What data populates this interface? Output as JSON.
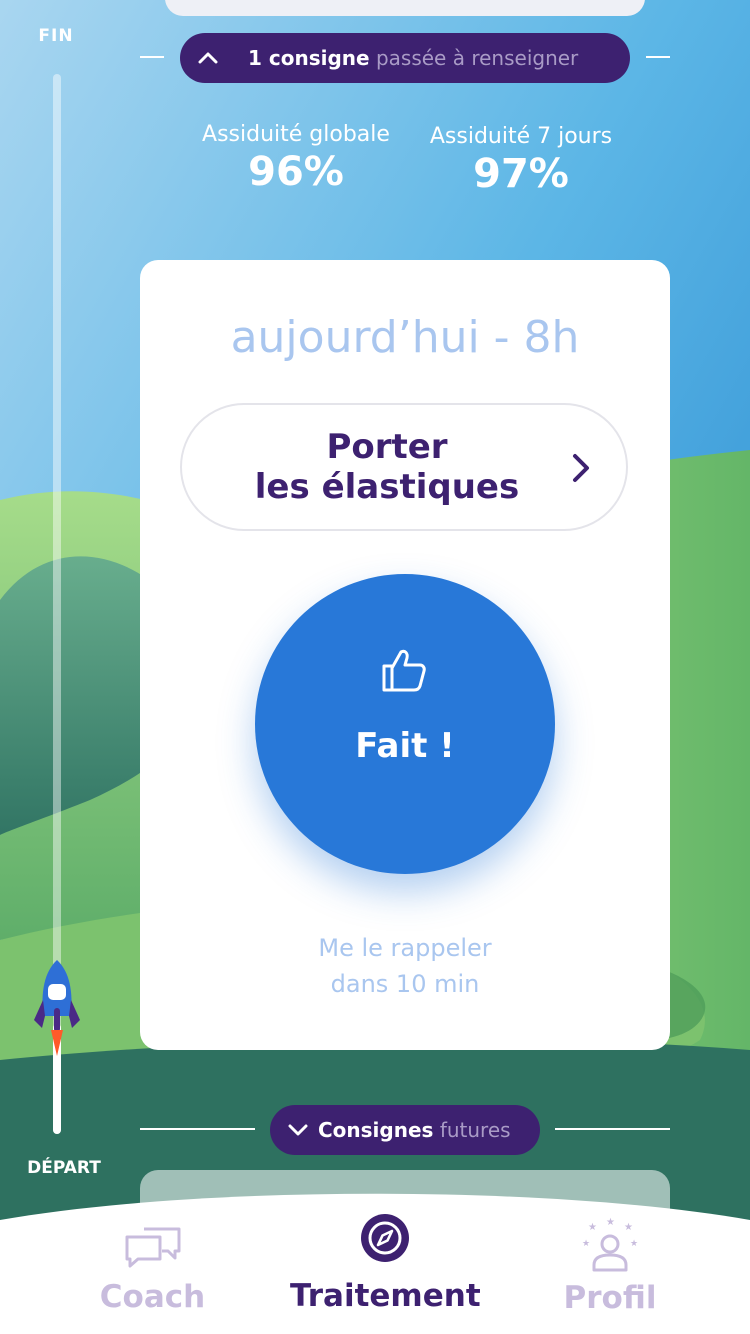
{
  "progress": {
    "top_label": "FIN",
    "bottom_label": "DÉPART",
    "fraction": 0.05
  },
  "past_pill": {
    "count_label": "1 consigne",
    "rest_label": "passée à renseigner"
  },
  "stats": {
    "global_label": "Assiduité globale",
    "global_value": "96%",
    "week_label": "Assiduité 7 jours",
    "week_value": "97%"
  },
  "task_card": {
    "time_label": "aujourd’hui - 8h",
    "task_line1": "Porter",
    "task_line2": "les élastiques",
    "done_label": "Fait !",
    "remind_line1": "Me le rappeler",
    "remind_line2": "dans 10 min"
  },
  "future_pill": {
    "bold_label": "Consignes",
    "rest_label": "futures"
  },
  "tabbar": {
    "coach": "Coach",
    "treatment": "Traitement",
    "profile": "Profil"
  },
  "colors": {
    "primary_purple": "#3d2170",
    "done_blue": "#2878d8",
    "muted_blue": "#a9c6ef",
    "tab_inactive": "#c8bcdd"
  }
}
